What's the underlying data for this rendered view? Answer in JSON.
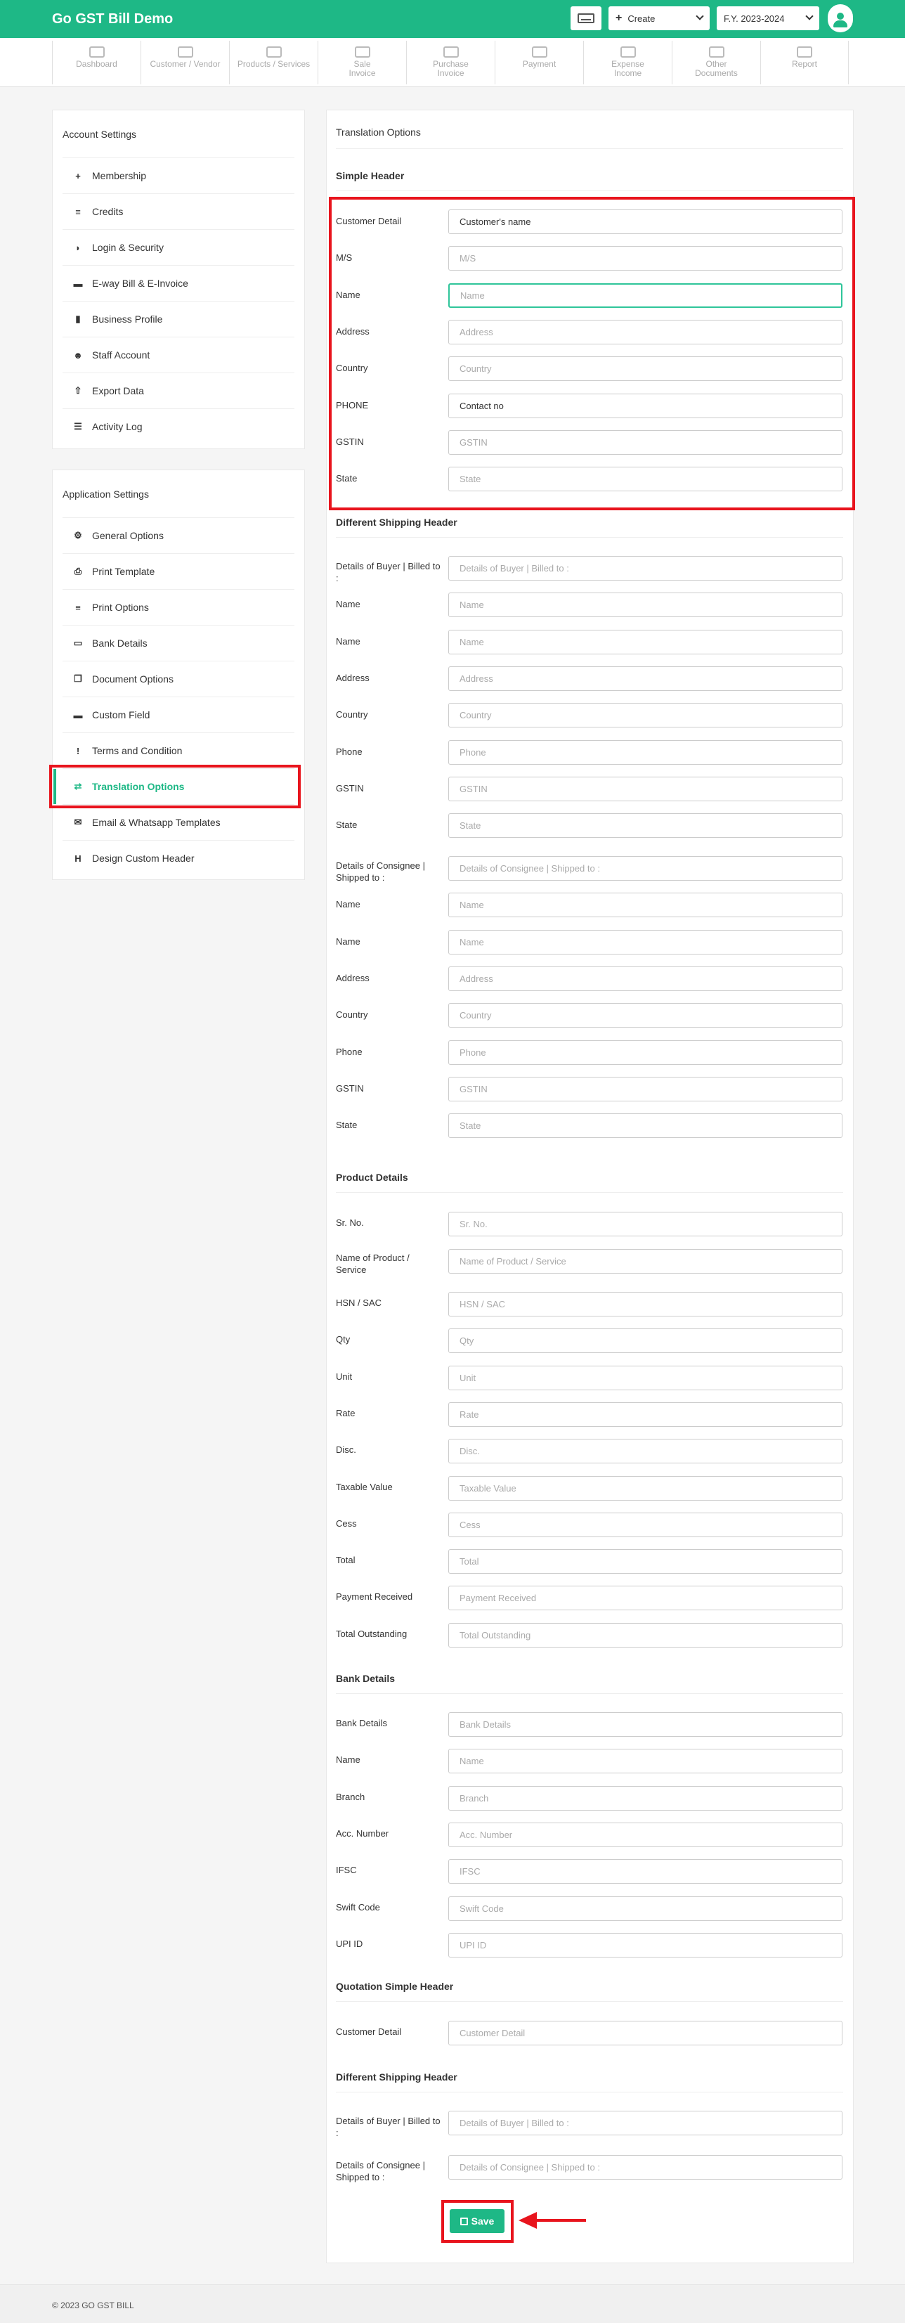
{
  "brand": "Go GST Bill Demo",
  "header": {
    "create_label": "Create",
    "fy_label": "F.Y. 2023-2024"
  },
  "nav": [
    {
      "line1": "Dashboard",
      "line2": ""
    },
    {
      "line1": "Customer / Vendor",
      "line2": ""
    },
    {
      "line1": "Products / Services",
      "line2": ""
    },
    {
      "line1": "Sale",
      "line2": "Invoice"
    },
    {
      "line1": "Purchase",
      "line2": "Invoice"
    },
    {
      "line1": "Payment",
      "line2": ""
    },
    {
      "line1": "Expense",
      "line2": "Income"
    },
    {
      "line1": "Other",
      "line2": "Documents"
    },
    {
      "line1": "Report",
      "line2": ""
    }
  ],
  "account_settings": {
    "title": "Account Settings",
    "items": [
      "Membership",
      "Credits",
      "Login & Security",
      "E-way Bill & E-Invoice",
      "Business Profile",
      "Staff Account",
      "Export Data",
      "Activity Log"
    ],
    "icons": [
      "user-plus-icon",
      "database-icon",
      "shield-icon",
      "truck-icon",
      "building-icon",
      "users-icon",
      "upload-icon",
      "list-icon"
    ]
  },
  "application_settings": {
    "title": "Application Settings",
    "items": [
      "General Options",
      "Print Template",
      "Print Options",
      "Bank Details",
      "Document Options",
      "Custom Field",
      "Terms and Condition",
      "Translation Options",
      "Email & Whatsapp Templates",
      "Design Custom Header"
    ],
    "icons": [
      "cogs-icon",
      "print-icon",
      "align-icon",
      "credit-card-icon",
      "copy-icon",
      "folder-icon",
      "exclamation-icon",
      "exchange-icon",
      "envelope-icon",
      "header-icon"
    ]
  },
  "form": {
    "title": "Translation Options",
    "simple_header": {
      "title": "Simple Header",
      "fields": [
        {
          "label": "Customer Detail",
          "value": "Customer's name",
          "placeholder": ""
        },
        {
          "label": "M/S",
          "value": "",
          "placeholder": "M/S"
        },
        {
          "label": "Name",
          "value": "",
          "placeholder": "Name"
        },
        {
          "label": "Address",
          "value": "",
          "placeholder": "Address"
        },
        {
          "label": "Country",
          "value": "",
          "placeholder": "Country"
        },
        {
          "label": "PHONE",
          "value": "Contact no",
          "placeholder": ""
        },
        {
          "label": "GSTIN",
          "value": "",
          "placeholder": "GSTIN"
        },
        {
          "label": "State",
          "value": "",
          "placeholder": "State"
        }
      ]
    },
    "different_shipping_header": {
      "title": "Different Shipping Header",
      "fields": [
        {
          "label": "Details of Buyer | Billed to :",
          "placeholder": "Details of Buyer | Billed to :"
        },
        {
          "label": "Name",
          "placeholder": "Name"
        },
        {
          "label": "Name",
          "placeholder": "Name"
        },
        {
          "label": "Address",
          "placeholder": "Address"
        },
        {
          "label": "Country",
          "placeholder": "Country"
        },
        {
          "label": "Phone",
          "placeholder": "Phone"
        },
        {
          "label": "GSTIN",
          "placeholder": "GSTIN"
        },
        {
          "label": "State",
          "placeholder": "State"
        },
        {
          "label": "Details of Consignee | Shipped to :",
          "placeholder": "Details of Consignee | Shipped to :"
        },
        {
          "label": "Name",
          "placeholder": "Name"
        },
        {
          "label": "Name",
          "placeholder": "Name"
        },
        {
          "label": "Address",
          "placeholder": "Address"
        },
        {
          "label": "Country",
          "placeholder": "Country"
        },
        {
          "label": "Phone",
          "placeholder": "Phone"
        },
        {
          "label": "GSTIN",
          "placeholder": "GSTIN"
        },
        {
          "label": "State",
          "placeholder": "State"
        }
      ]
    },
    "product_details": {
      "title": "Product Details",
      "fields": [
        {
          "label": "Sr. No.",
          "placeholder": "Sr. No."
        },
        {
          "label": "Name of Product / Service",
          "placeholder": "Name of Product / Service"
        },
        {
          "label": "HSN / SAC",
          "placeholder": "HSN / SAC"
        },
        {
          "label": "Qty",
          "placeholder": "Qty"
        },
        {
          "label": "Unit",
          "placeholder": "Unit"
        },
        {
          "label": "Rate",
          "placeholder": "Rate"
        },
        {
          "label": "Disc.",
          "placeholder": "Disc."
        },
        {
          "label": "Taxable Value",
          "placeholder": "Taxable Value"
        },
        {
          "label": "Cess",
          "placeholder": "Cess"
        },
        {
          "label": "Total",
          "placeholder": "Total"
        },
        {
          "label": "Payment Received",
          "placeholder": "Payment Received"
        },
        {
          "label": "Total Outstanding",
          "placeholder": "Total Outstanding"
        }
      ]
    },
    "bank_details": {
      "title": "Bank Details",
      "fields": [
        {
          "label": "Bank Details",
          "placeholder": "Bank Details"
        },
        {
          "label": "Name",
          "placeholder": "Name"
        },
        {
          "label": "Branch",
          "placeholder": "Branch"
        },
        {
          "label": "Acc. Number",
          "placeholder": "Acc. Number"
        },
        {
          "label": "IFSC",
          "placeholder": "IFSC"
        },
        {
          "label": "Swift Code",
          "placeholder": "Swift Code"
        },
        {
          "label": "UPI ID",
          "placeholder": "UPI ID"
        }
      ]
    },
    "quotation_simple_header": {
      "title": "Quotation Simple Header",
      "fields": [
        {
          "label": "Customer Detail",
          "placeholder": "Customer Detail"
        }
      ]
    },
    "quotation_shipping_header": {
      "title": "Different Shipping Header",
      "fields": [
        {
          "label": "Details of Buyer | Billed to :",
          "placeholder": "Details of Buyer | Billed to :"
        },
        {
          "label": "Details of Consignee | Shipped to :",
          "placeholder": "Details of Consignee | Shipped to :"
        }
      ]
    },
    "save_label": "Save"
  },
  "footer": "© 2023 GO GST BILL",
  "colors": {
    "accent": "#1eb886",
    "highlight": "#e8141d"
  }
}
